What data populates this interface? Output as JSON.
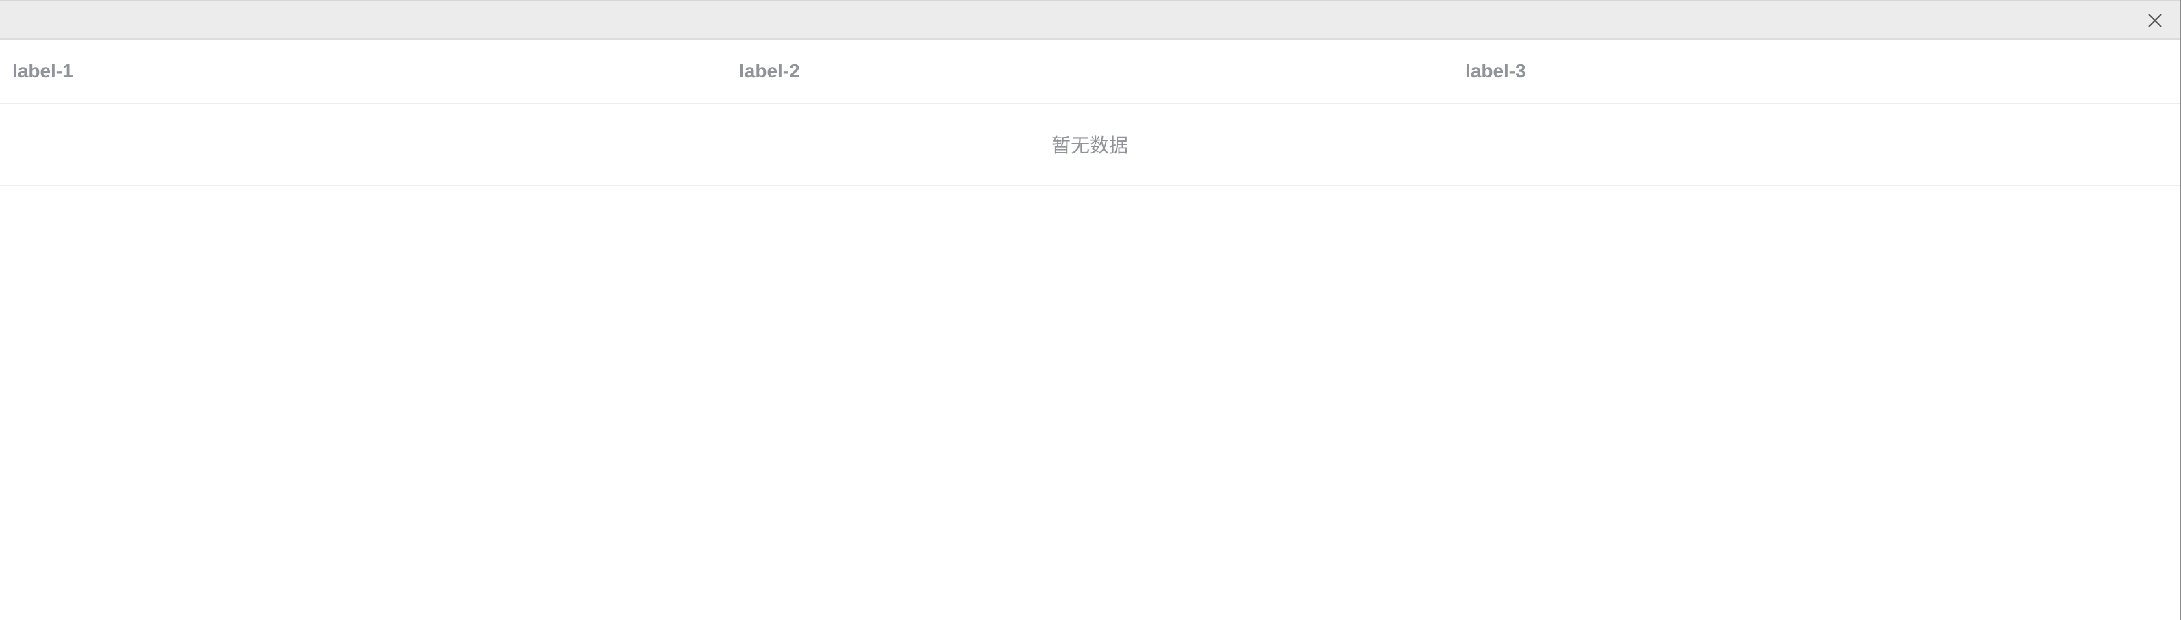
{
  "dialog": {
    "close_icon": "close-icon"
  },
  "table": {
    "columns": [
      "label-1",
      "label-2",
      "label-3"
    ],
    "empty_text": "暂无数据"
  },
  "colors": {
    "title_bar": "#ececec",
    "header_text": "#909399",
    "border": "#ebeef5"
  }
}
